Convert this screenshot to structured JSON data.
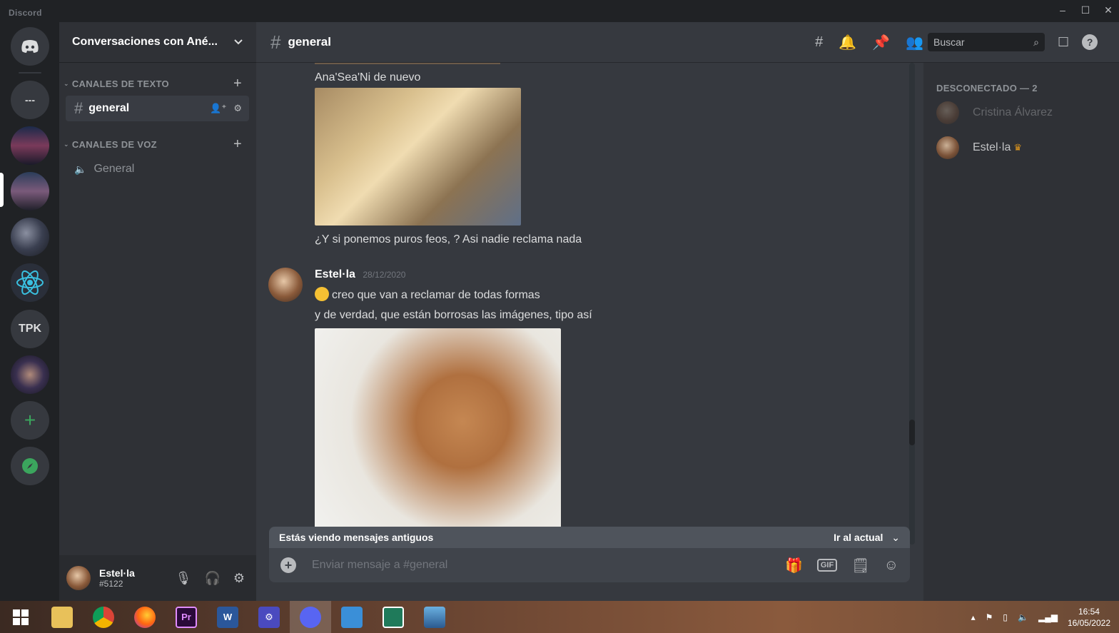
{
  "app": {
    "title": "Discord"
  },
  "window_controls": {
    "minimize": "–",
    "maximize": "☐",
    "close": "✕"
  },
  "guilds": [
    {
      "name": "home",
      "label": ""
    },
    {
      "name": "dm",
      "label": "---"
    },
    {
      "name": "tpk",
      "label": "TPK"
    },
    {
      "name": "add-server",
      "label": "+"
    }
  ],
  "server": {
    "name": "Conversaciones con Ané..."
  },
  "categories": {
    "text": "CANALES DE TEXTO",
    "voice": "CANALES DE VOZ"
  },
  "channels": {
    "text": [
      "general"
    ],
    "voice": [
      "General"
    ]
  },
  "user": {
    "name": "Estel·la",
    "tag": "#5122"
  },
  "chat": {
    "channel": "general",
    "search_placeholder": "Buscar",
    "messages": {
      "m1": "Ana'Sea'Ni   de nuevo",
      "m2": "¿Y si ponemos  puros feos,  ? Asi nadie reclama nada",
      "author": "Estel·la",
      "timestamp": "28/12/2020",
      "m3": "creo que van a reclamar de todas formas",
      "m4": "y de verdad, que están borrosas las imágenes, tipo así"
    },
    "older_notice": "Estás viendo mensajes antiguos",
    "jump_present": "Ir al actual",
    "composer_placeholder": "Enviar mensaje a #general",
    "gif_label": "GIF"
  },
  "members": {
    "header": "DESCONECTADO — 2",
    "list": [
      "Cristina Álvarez",
      "Estel·la"
    ]
  },
  "taskbar": {
    "premiere_label": "Pr",
    "word_label": "W",
    "time": "16:54",
    "date": "16/05/2022"
  },
  "colors": {
    "background": "#36393f",
    "sidebar": "#2f3136",
    "guild_bar": "#202225",
    "accent": "#5865f2",
    "online": "#3ba55d",
    "crown": "#faa61a"
  }
}
